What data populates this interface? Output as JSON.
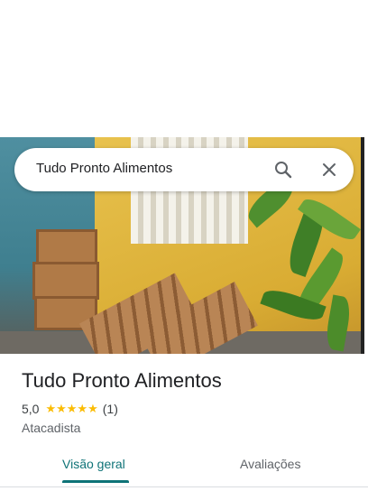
{
  "search": {
    "query": "Tudo Pronto Alimentos",
    "search_icon": "search-icon",
    "close_icon": "close-icon"
  },
  "place": {
    "name": "Tudo Pronto Alimentos",
    "rating": "5,0",
    "stars": "★★★★★",
    "rating_value": 5,
    "review_count": "(1)",
    "category": "Atacadista"
  },
  "tabs": [
    {
      "label": "Visão geral",
      "active": true
    },
    {
      "label": "Avaliações",
      "active": false
    }
  ],
  "colors": {
    "accent": "#0e7377",
    "star": "#fbbc04",
    "text": "#202124",
    "muted": "#5f6368"
  }
}
